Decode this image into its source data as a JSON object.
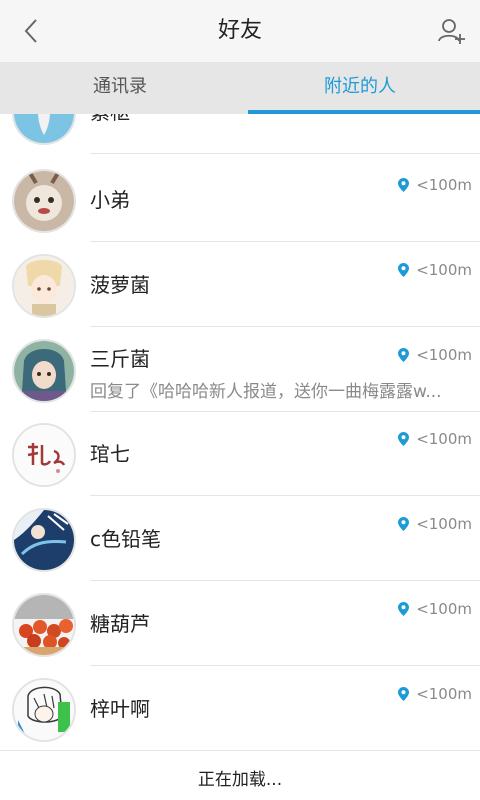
{
  "header": {
    "title": "好友",
    "back_icon": "chevron-left-icon",
    "add_friend_icon": "add-user-icon"
  },
  "tabs": [
    {
      "label": "通讯录",
      "active": false
    },
    {
      "label": "附近的人",
      "active": true
    }
  ],
  "accent_color": "#1e9bd7",
  "list": {
    "items": [
      {
        "name": "紫枢",
        "distance": "",
        "message": ""
      },
      {
        "name": "小弟",
        "distance": "<100m",
        "message": ""
      },
      {
        "name": "菠萝菌",
        "distance": "<100m",
        "message": ""
      },
      {
        "name": "三斤菌",
        "distance": "<100m",
        "message": "回复了《哈哈哈新人报道，送你一曲梅露露w..."
      },
      {
        "name": "琯七",
        "distance": "<100m",
        "message": ""
      },
      {
        "name": "c色铅笔",
        "distance": "<100m",
        "message": ""
      },
      {
        "name": "糖葫芦",
        "distance": "<100m",
        "message": ""
      },
      {
        "name": "梓叶啊",
        "distance": "<100m",
        "message": ""
      }
    ]
  },
  "footer": {
    "loading_text": "正在加载..."
  }
}
